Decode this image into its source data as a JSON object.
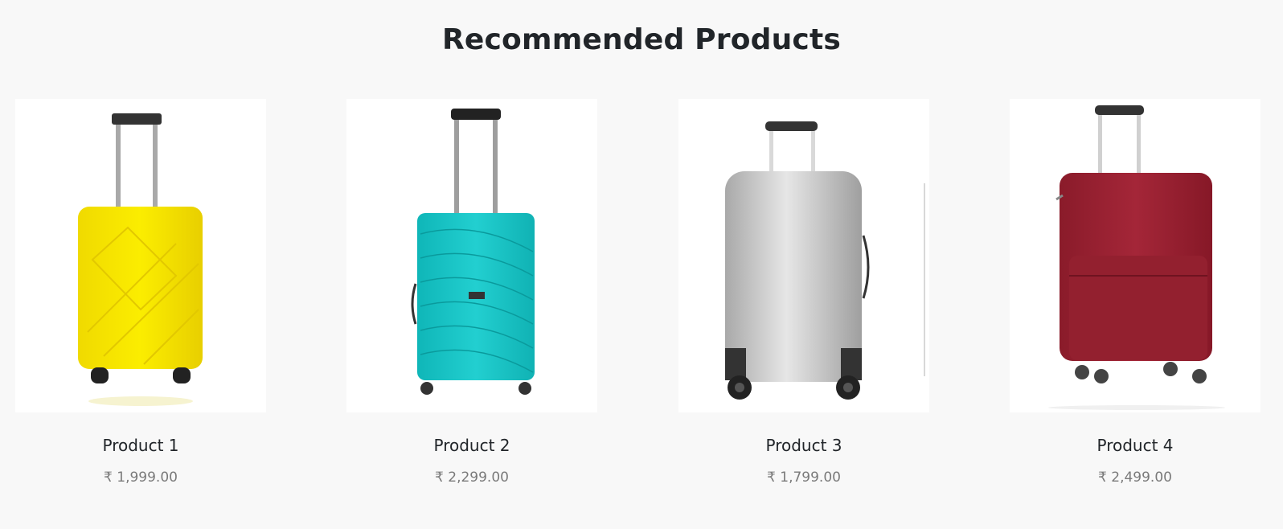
{
  "section": {
    "title": "Recommended Products"
  },
  "products": [
    {
      "name": "Product 1",
      "price": "₹ 1,999.00",
      "image": "yellow-suitcase-icon",
      "color": "#f2e200"
    },
    {
      "name": "Product 2",
      "price": "₹ 2,299.00",
      "image": "teal-suitcase-icon",
      "color": "#17c3c5"
    },
    {
      "name": "Product 3",
      "price": "₹ 1,799.00",
      "image": "silver-suitcase-icon",
      "color": "#c4c4c4"
    },
    {
      "name": "Product 4",
      "price": "₹ 2,499.00",
      "image": "maroon-suitcase-icon",
      "color": "#9e2234"
    }
  ]
}
